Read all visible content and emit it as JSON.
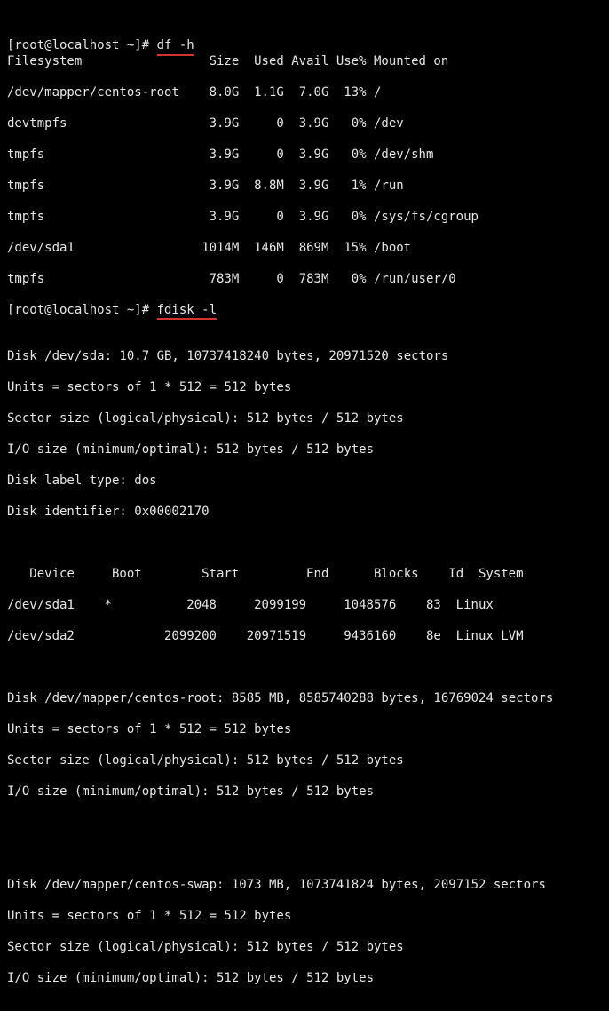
{
  "prompt": "[root@localhost ~]# ",
  "cmd1": "df -h",
  "cmd2": "fdisk -l",
  "df": {
    "headers": {
      "fs": "Filesystem",
      "size": "Size",
      "used": "Used",
      "avail": "Avail",
      "usep": "Use%",
      "mnt": "Mounted on"
    },
    "rows": [
      {
        "fs": "/dev/mapper/centos-root",
        "size": "8.0G",
        "used": "1.1G",
        "avail": "7.0G",
        "usep": "13%",
        "mnt": "/"
      },
      {
        "fs": "devtmpfs",
        "size": "3.9G",
        "used": "0",
        "avail": "3.9G",
        "usep": "0%",
        "mnt": "/dev"
      },
      {
        "fs": "tmpfs",
        "size": "3.9G",
        "used": "0",
        "avail": "3.9G",
        "usep": "0%",
        "mnt": "/dev/shm"
      },
      {
        "fs": "tmpfs",
        "size": "3.9G",
        "used": "8.8M",
        "avail": "3.9G",
        "usep": "1%",
        "mnt": "/run"
      },
      {
        "fs": "tmpfs",
        "size": "3.9G",
        "used": "0",
        "avail": "3.9G",
        "usep": "0%",
        "mnt": "/sys/fs/cgroup"
      },
      {
        "fs": "/dev/sda1",
        "size": "1014M",
        "used": "146M",
        "avail": "869M",
        "usep": "15%",
        "mnt": "/boot"
      },
      {
        "fs": "tmpfs",
        "size": "783M",
        "used": "0",
        "avail": "783M",
        "usep": "0%",
        "mnt": "/run/user/0"
      }
    ]
  },
  "fdisk": {
    "sda": {
      "l1": "Disk /dev/sda: 10.7 GB, 10737418240 bytes, 20971520 sectors",
      "l2": "Units = sectors of 1 * 512 = 512 bytes",
      "l3": "Sector size (logical/physical): 512 bytes / 512 bytes",
      "l4": "I/O size (minimum/optimal): 512 bytes / 512 bytes",
      "l5": "Disk label type: dos",
      "l6": "Disk identifier: 0x00002170"
    },
    "partHeaders": {
      "device": "Device",
      "boot": "Boot",
      "start": "Start",
      "end": "End",
      "blocks": "Blocks",
      "id": "Id",
      "system": "System"
    },
    "partHeaderIndent": "   ",
    "partitions": [
      {
        "device": "/dev/sda1",
        "boot": "*",
        "start": "2048",
        "end": "2099199",
        "blocks": "1048576",
        "id": "83",
        "system": "Linux"
      },
      {
        "device": "/dev/sda2",
        "boot": " ",
        "start": "2099200",
        "end": "20971519",
        "blocks": "9436160",
        "id": "8e",
        "system": "Linux LVM"
      }
    ],
    "root": {
      "l1": "Disk /dev/mapper/centos-root: 8585 MB, 8585740288 bytes, 16769024 sectors",
      "l2": "Units = sectors of 1 * 512 = 512 bytes",
      "l3": "Sector size (logical/physical): 512 bytes / 512 bytes",
      "l4": "I/O size (minimum/optimal): 512 bytes / 512 bytes"
    },
    "swap": {
      "l1": "Disk /dev/mapper/centos-swap: 1073 MB, 1073741824 bytes, 2097152 sectors",
      "l2": "Units = sectors of 1 * 512 = 512 bytes",
      "l3": "Sector size (logical/physical): 512 bytes / 512 bytes",
      "l4": "I/O size (minimum/optimal): 512 bytes / 512 bytes"
    }
  }
}
